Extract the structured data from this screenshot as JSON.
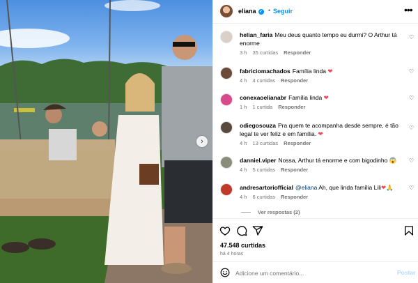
{
  "header": {
    "username": "eliana",
    "separator": "•",
    "follow_label": "Seguir",
    "more_icon": "more-horizontal-icon"
  },
  "comments": [
    {
      "user": "helian_faria",
      "text": "Meu deus quanto tempo eu durmi? O Arthur tá enorme",
      "time": "3 h",
      "likes": "35 curtidas",
      "reply": "Responder",
      "avatar_color": "#d9d0c7"
    },
    {
      "user": "fabriciomachados",
      "text": "Família linda",
      "emoji": "❤",
      "time": "4 h",
      "likes": "4 curtidas",
      "reply": "Responder",
      "avatar_color": "#6b4a3a"
    },
    {
      "user": "conexaoelianabr",
      "text": "Família linda",
      "emoji": "❤",
      "time": "1 h",
      "likes": "1 curtida",
      "reply": "Responder",
      "avatar_color": "#d94a8c"
    },
    {
      "user": "odiegosouza",
      "text": "Pra quem te acompanha desde sempre, é tão legal te ver feliz e em família.",
      "emoji": "❤",
      "time": "4 h",
      "likes": "13 curtidas",
      "reply": "Responder",
      "avatar_color": "#5a4a3e"
    },
    {
      "user": "danniel.viper",
      "text": "Nossa, Arthur tá enorme e com bigodinho",
      "emoji": "😱",
      "time": "4 h",
      "likes": "5 curtidas",
      "reply": "Responder",
      "avatar_color": "#8a8d7a"
    },
    {
      "user": "andresartoriofficial",
      "mention": "@eliana",
      "text": "Ah, que linda família Lili",
      "emoji": "❤🙏",
      "time": "4 h",
      "likes": "6 curtidas",
      "reply": "Responder",
      "avatar_color": "#c0392b"
    }
  ],
  "view_replies": "Ver respostas (2)",
  "actions": {
    "likes_count": "47.548 curtidas",
    "timestamp": "há 4 horas"
  },
  "add_comment": {
    "placeholder": "Adicione um comentário...",
    "post_label": "Postar"
  },
  "colors": {
    "accent": "#0095f6",
    "heart": "#ed4956",
    "post_disabled": "#b3dbff"
  }
}
